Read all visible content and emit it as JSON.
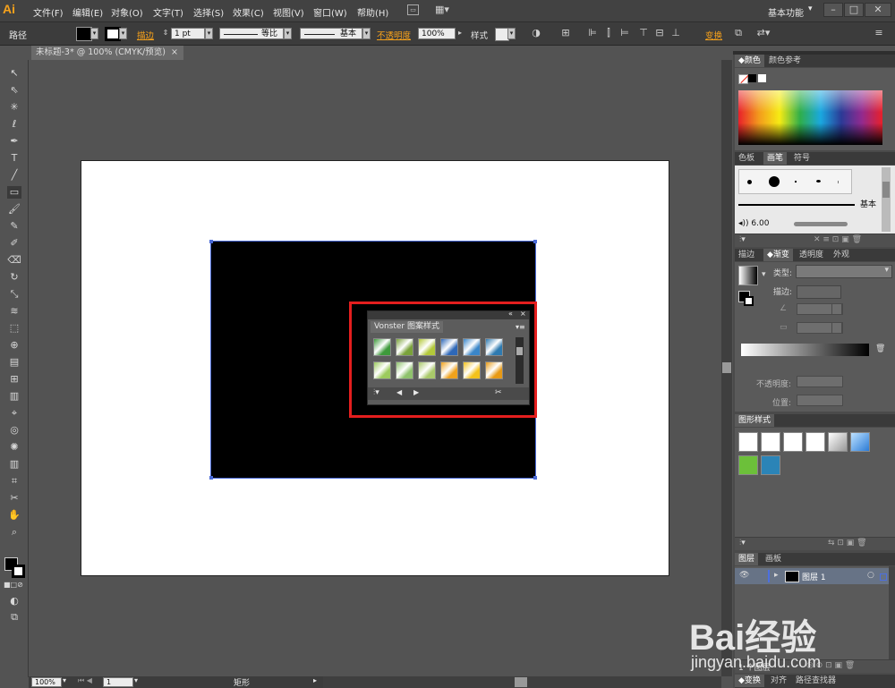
{
  "app": {
    "logo": "Ai",
    "workspace": "基本功能"
  },
  "menu": [
    "文件(F)",
    "编辑(E)",
    "对象(O)",
    "文字(T)",
    "选择(S)",
    "效果(C)",
    "视图(V)",
    "窗口(W)",
    "帮助(H)"
  ],
  "control": {
    "selection_label": "路径",
    "stroke_label": "描边",
    "stroke_weight": "1 pt",
    "profile_label": "等比",
    "brush_label": "基本",
    "opacity_label": "不透明度",
    "opacity_value": "100%",
    "style_label": "样式",
    "transform_label": "变换"
  },
  "document": {
    "tab": "未标题-3* @ 100% (CMYK/预览)",
    "close": "×"
  },
  "status": {
    "zoom": "100%",
    "page": "1",
    "tool": "矩形"
  },
  "floating_panel": {
    "title": "Vonster 图案样式",
    "pattern_row1": [
      "#3e9a3b",
      "#7aa23a",
      "#b3c93a",
      "#2e68b8",
      "#3a86c9",
      "#2e7ab0"
    ],
    "pattern_row2": [
      "#9ccb5d",
      "#8fc26d",
      "#a9c96a",
      "#f0a21c",
      "#f4c21b",
      "#e89a15"
    ]
  },
  "panels": {
    "color": {
      "tabs": [
        "色板",
        "颜色参考"
      ],
      "tab0": "颜色",
      "tab1": "颜色参考"
    },
    "brush": {
      "tabs": [
        "色板",
        "画笔",
        "符号"
      ],
      "basic_label": "基本",
      "size": "6.00"
    },
    "gradient": {
      "tabs": [
        "描边",
        "渐变",
        "透明度",
        "外观"
      ],
      "type_label": "类型:",
      "stroke_label": "描边:",
      "opacity_label": "不透明度:",
      "position_label": "位置:"
    },
    "graphic_styles": {
      "title": "图形样式"
    },
    "layers": {
      "tabs": [
        "图层",
        "画板"
      ],
      "layer_name": "图层 1",
      "count": "1 个图层"
    },
    "bottom": {
      "tabs": [
        "变换",
        "对齐",
        "路径查找器"
      ]
    }
  },
  "watermark": {
    "brand": "Bai经验",
    "url": "jingyan.baidu.com"
  },
  "colors": {
    "accent": "#f7a21b",
    "selection": "#4a6ad6",
    "highlight": "#e41e1e"
  }
}
